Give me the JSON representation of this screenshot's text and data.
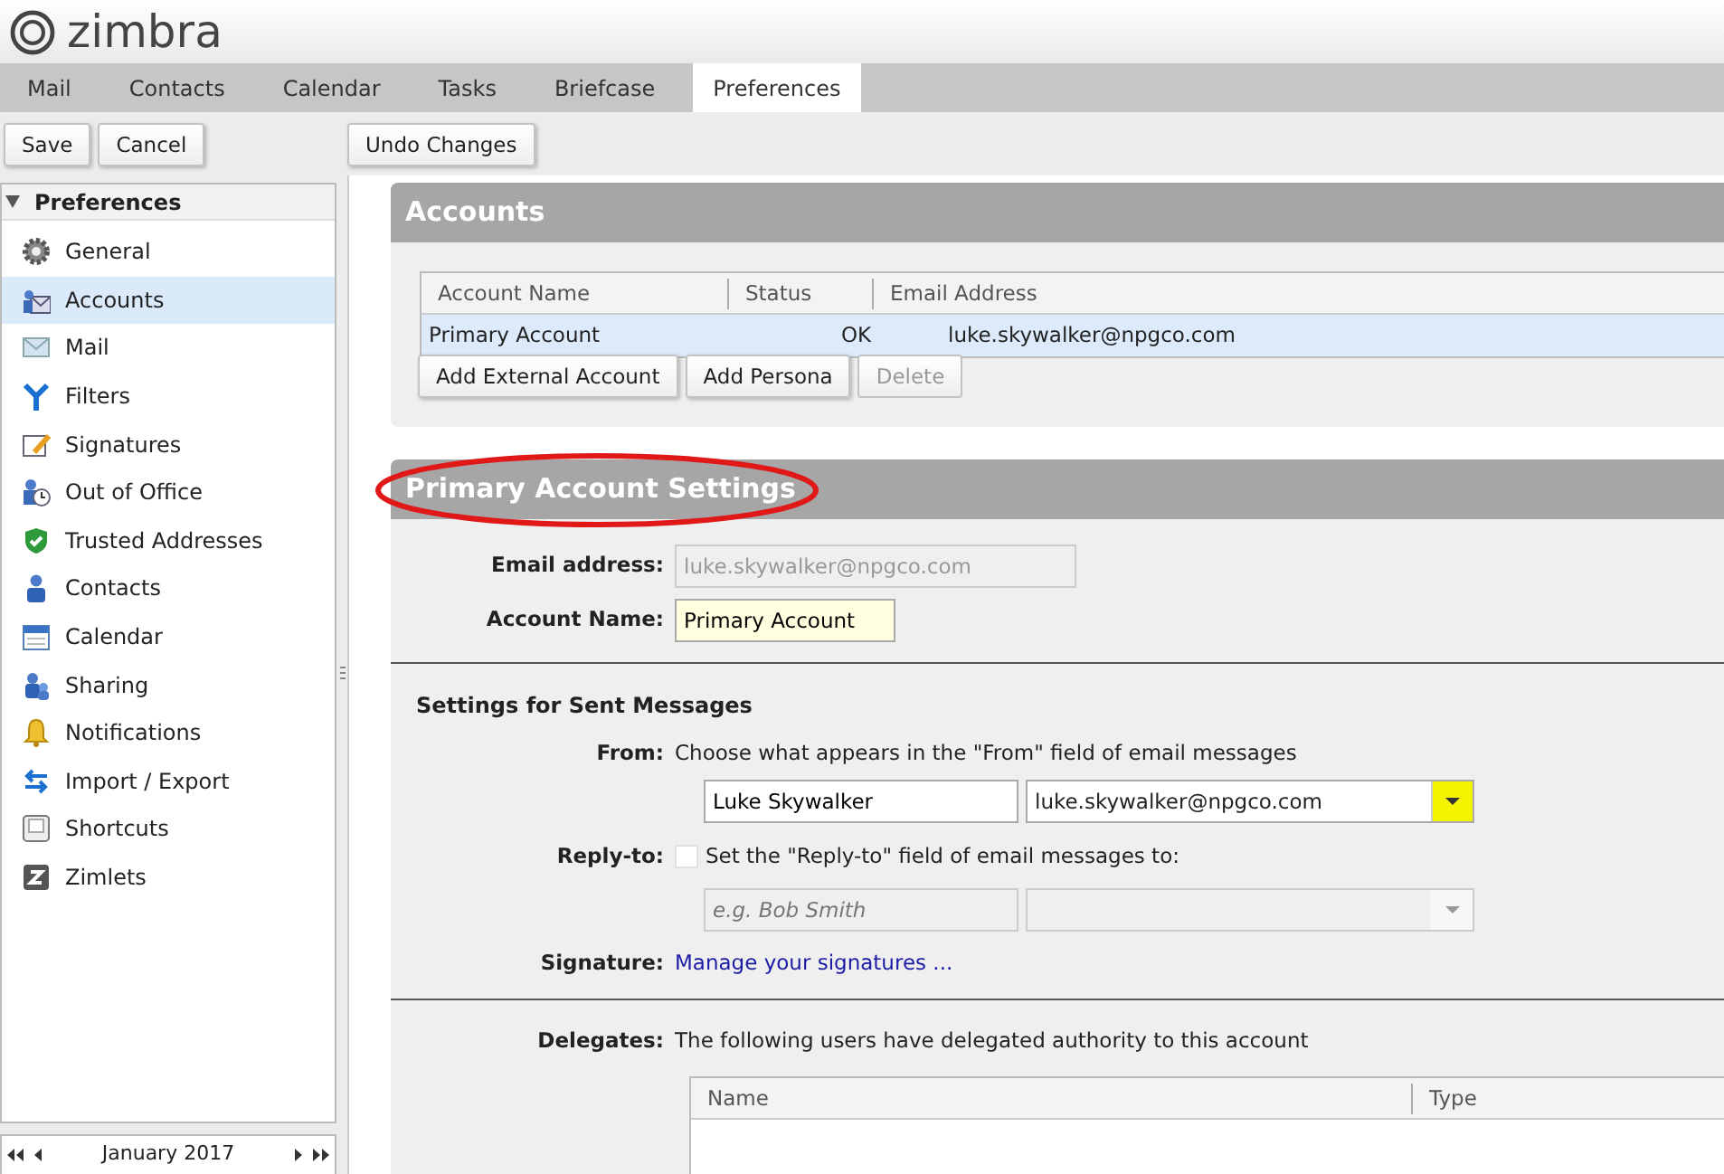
{
  "app": {
    "logo": "zimbra"
  },
  "tabs": [
    {
      "label": "Mail",
      "selected": false
    },
    {
      "label": "Contacts",
      "selected": false
    },
    {
      "label": "Calendar",
      "selected": false
    },
    {
      "label": "Tasks",
      "selected": false
    },
    {
      "label": "Briefcase",
      "selected": false
    },
    {
      "label": "Preferences",
      "selected": true
    }
  ],
  "toolbar": {
    "left_buttons": [
      "Save",
      "Cancel"
    ],
    "main_buttons": [
      "Undo Changes"
    ]
  },
  "sidebar": {
    "title": "Preferences",
    "expanded": true,
    "items": [
      {
        "label": "General",
        "selected": false
      },
      {
        "label": "Accounts",
        "selected": true
      },
      {
        "label": "Mail",
        "selected": false
      },
      {
        "label": "Filters",
        "selected": false
      },
      {
        "label": "Signatures",
        "selected": false
      },
      {
        "label": "Out of Office",
        "selected": false
      },
      {
        "label": "Trusted Addresses",
        "selected": false
      },
      {
        "label": "Contacts",
        "selected": false
      },
      {
        "label": "Calendar",
        "selected": false
      },
      {
        "label": "Sharing",
        "selected": false
      },
      {
        "label": "Notifications",
        "selected": false
      },
      {
        "label": "Import / Export",
        "selected": false
      },
      {
        "label": "Shortcuts",
        "selected": false
      },
      {
        "label": "Zimlets",
        "selected": false
      }
    ]
  },
  "mini_calendar": {
    "month": "January 2017"
  },
  "accounts": {
    "title": "Accounts",
    "columns": [
      "Account Name",
      "Status",
      "Email Address"
    ],
    "rows": [
      {
        "cells": [
          "Primary Account",
          "OK",
          "luke.skywalker@npgco.com"
        ],
        "selected": true
      }
    ],
    "buttons": [
      {
        "label": "Add External Account",
        "disabled": false
      },
      {
        "label": "Add Persona",
        "disabled": false
      },
      {
        "label": "Delete",
        "disabled": true
      }
    ]
  },
  "settings": {
    "title": "Primary Account Settings",
    "title_circled": true,
    "email_address": {
      "label": "Email address:",
      "value": "luke.skywalker@npgco.com",
      "disabled": true
    },
    "account_name": {
      "label": "Account Name:",
      "value": "Primary Account"
    },
    "sent_title": "Settings for Sent Messages",
    "from": {
      "label": "From:",
      "description": "Choose what appears in the \"From\" field of email messages",
      "name_value": "Luke Skywalker",
      "email_value": "luke.skywalker@npgco.com",
      "dropdown_highlighted": true
    },
    "reply_to": {
      "label": "Reply-to:",
      "checked": false,
      "text": "Set the \"Reply-to\" field of email messages to:",
      "name_placeholder": "e.g. Bob Smith"
    },
    "signature": {
      "label": "Signature:",
      "link": "Manage your signatures ..."
    },
    "delegates": {
      "label": "Delegates:",
      "text": "The following users have delegated authority to this account",
      "columns": [
        "Name",
        "Type"
      ]
    }
  }
}
